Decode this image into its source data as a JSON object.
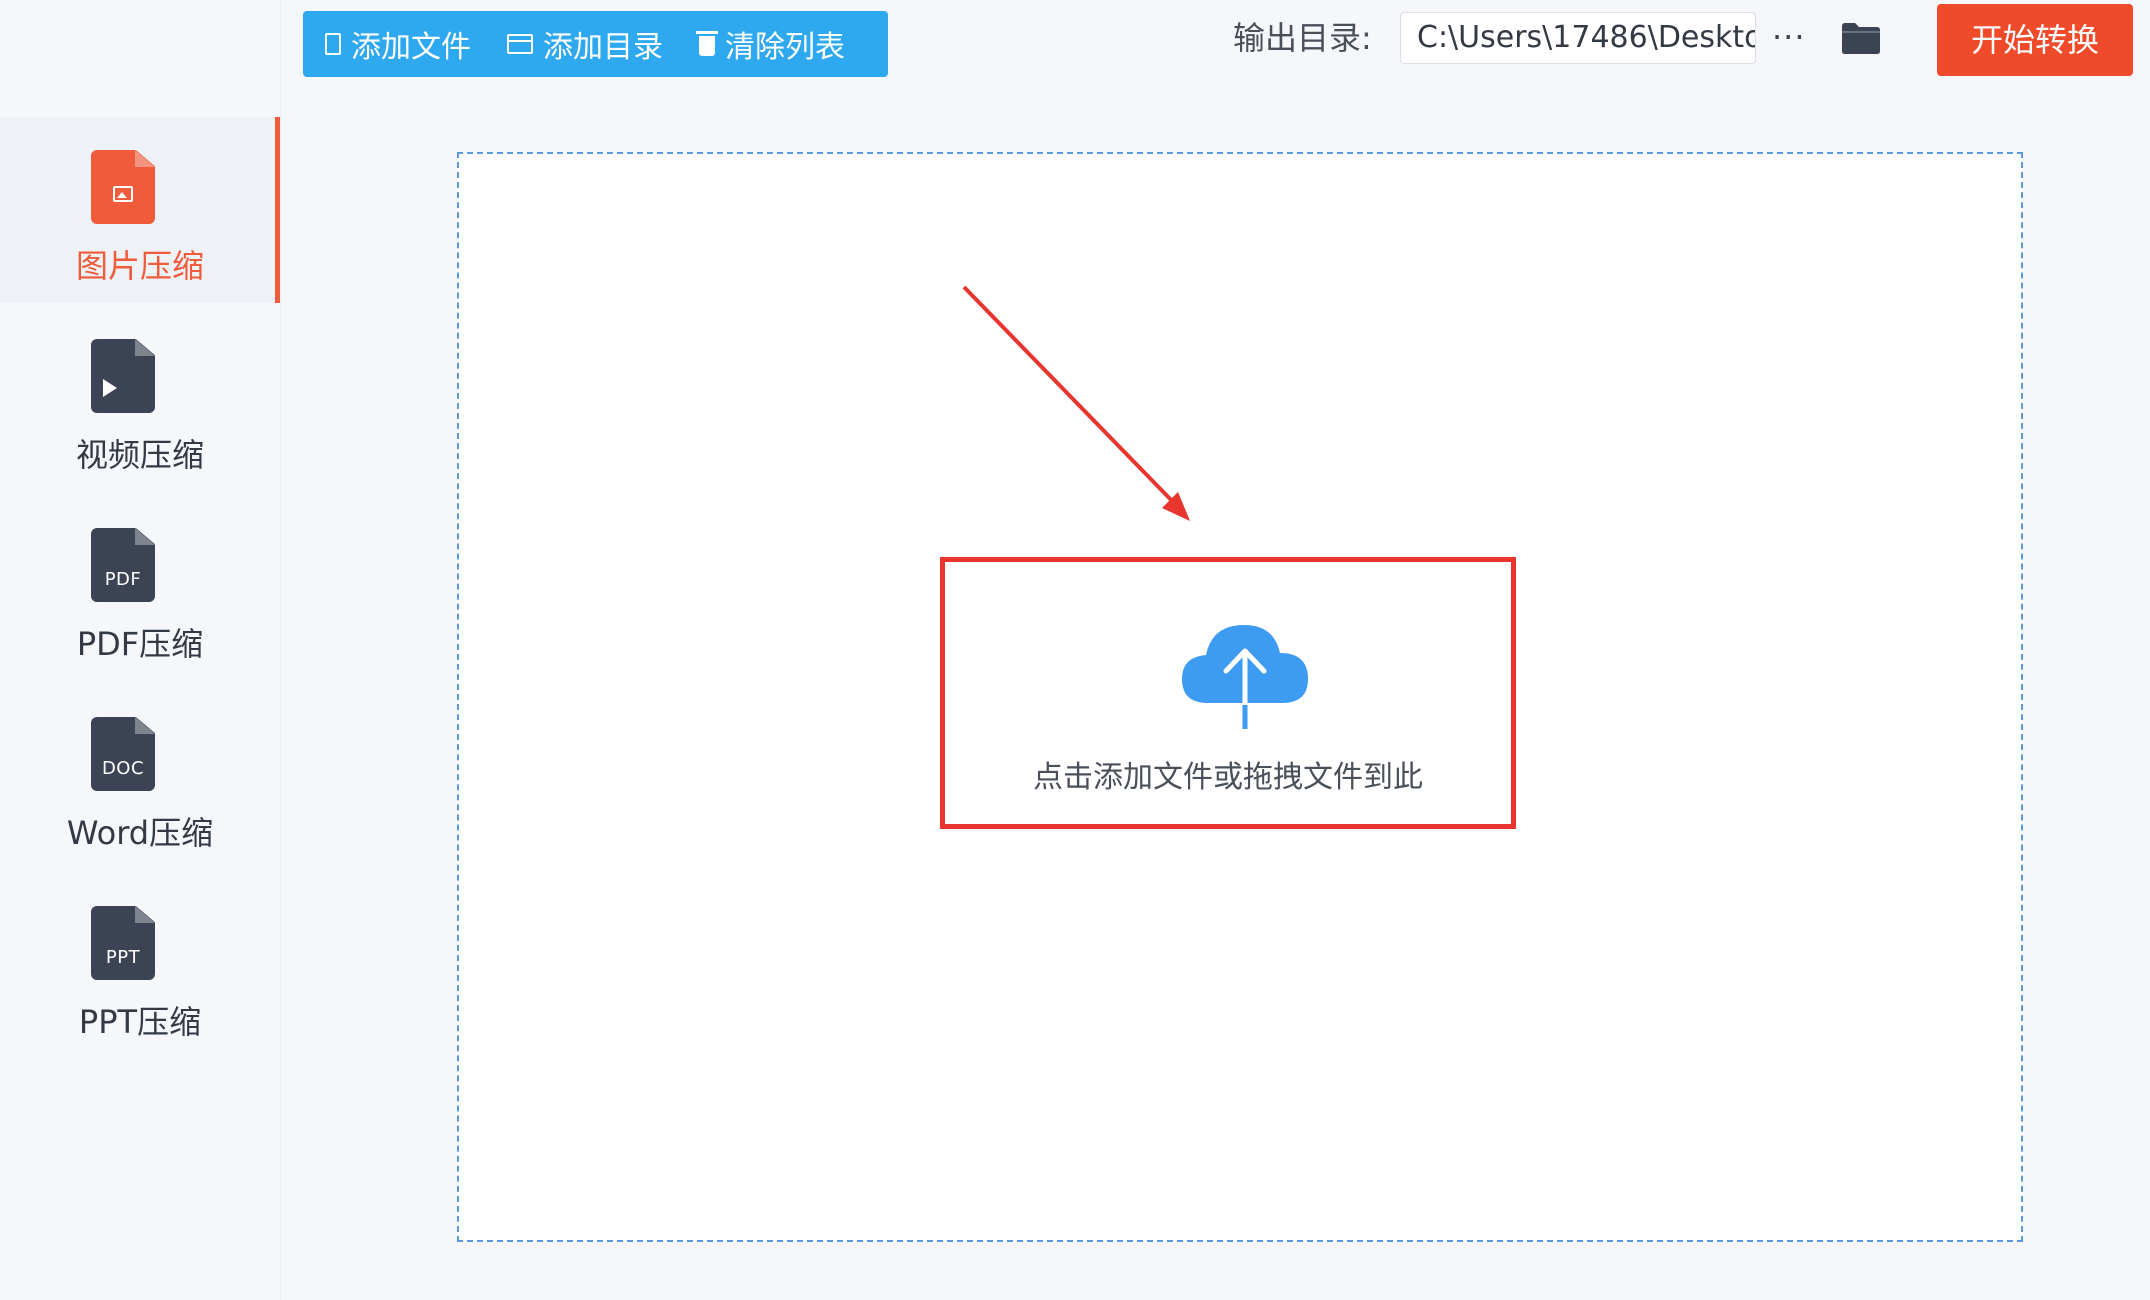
{
  "toolbar": {
    "add_file": "添加文件",
    "add_dir": "添加目录",
    "clear_list": "清除列表"
  },
  "output": {
    "label": "输出目录:",
    "path": "C:\\Users\\17486\\Deskto"
  },
  "more": "···",
  "start_button": "开始转换",
  "sidebar": {
    "items": [
      {
        "label": "图片压缩",
        "icon": "image-file-icon",
        "active": true
      },
      {
        "label": "视频压缩",
        "icon": "video-file-icon",
        "active": false
      },
      {
        "label": "PDF压缩",
        "icon": "pdf-file-icon",
        "badge": "PDF",
        "active": false
      },
      {
        "label": "Word压缩",
        "icon": "doc-file-icon",
        "badge": "DOC",
        "active": false
      },
      {
        "label": "PPT压缩",
        "icon": "ppt-file-icon",
        "badge": "PPT",
        "active": false
      }
    ]
  },
  "drop": {
    "text": "点击添加文件或拖拽文件到此"
  },
  "colors": {
    "accent_orange": "#ef4a2a",
    "toolbar_blue": "#2ea8ee",
    "annotation_red": "#e8362e",
    "cloud_blue": "#3d9cf2"
  }
}
